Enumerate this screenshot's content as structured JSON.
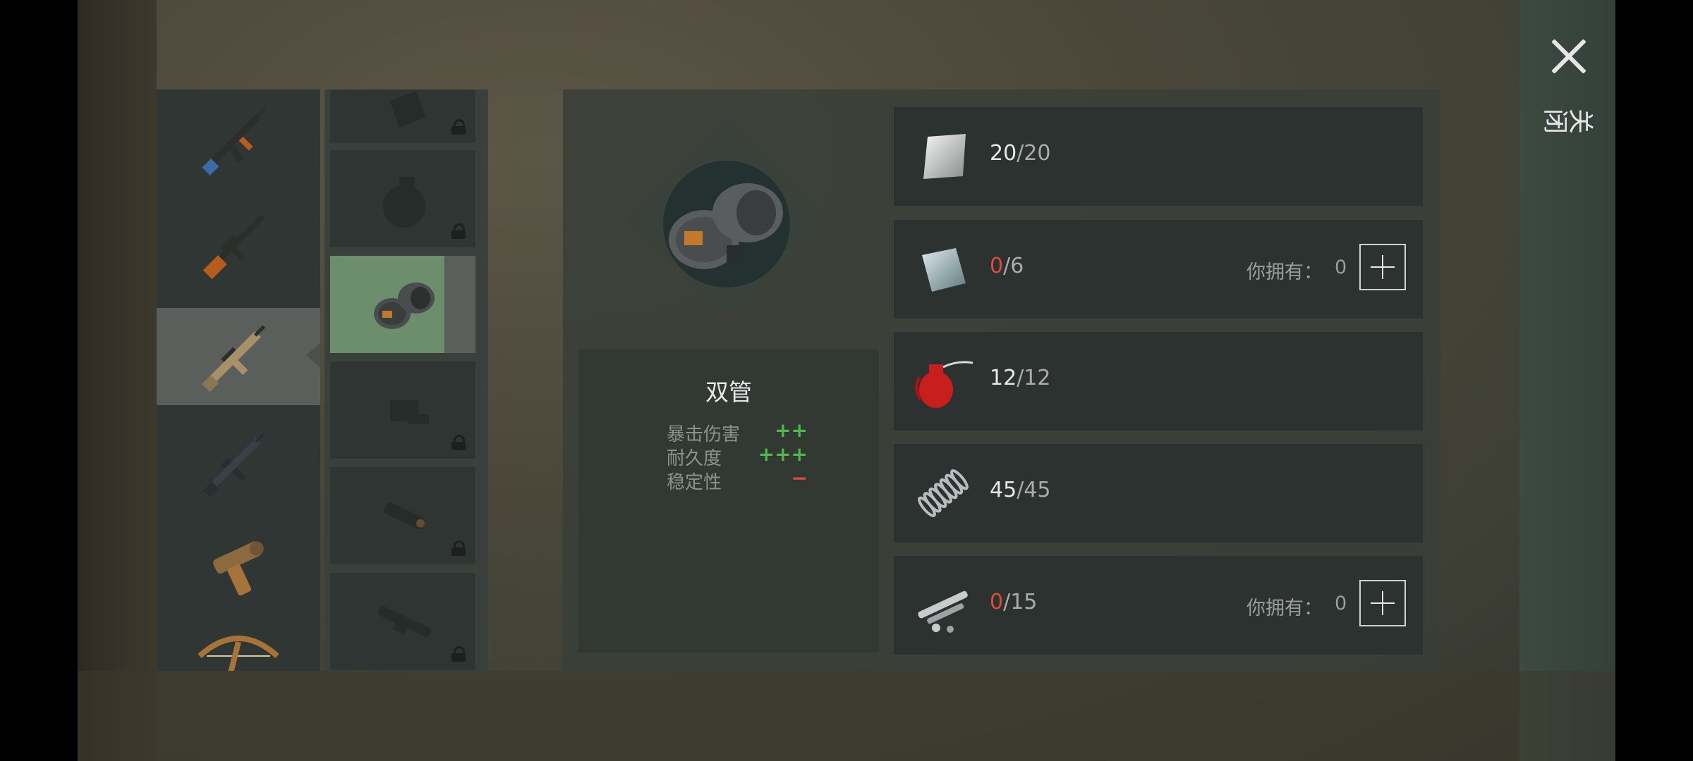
{
  "close": {
    "label": "关闭"
  },
  "weapons": [
    {
      "name": "ak-rifle-icon",
      "stock_color": "#3a6aa8"
    },
    {
      "name": "dragunov-rifle-icon",
      "stock_color": "#b85c1e"
    },
    {
      "name": "scar-rifle-icon",
      "stock_color": "#a8916a",
      "selected": true
    },
    {
      "name": "m4-rifle-icon",
      "stock_color": "#2a2e31"
    },
    {
      "name": "flare-pistol-icon",
      "stock_color": "#a67438"
    },
    {
      "name": "crossbow-icon",
      "stock_color": "#a67438"
    }
  ],
  "attachments": [
    {
      "name": "attachment-locked-top",
      "locked": true
    },
    {
      "name": "drum-magazine-icon",
      "locked": true
    },
    {
      "name": "double-drum-magazine-icon",
      "locked": false,
      "selected": true
    },
    {
      "name": "holographic-sight-icon",
      "locked": true
    },
    {
      "name": "red-dot-sight-icon",
      "locked": true
    },
    {
      "name": "scope-icon",
      "locked": true
    }
  ],
  "item": {
    "title": "双管",
    "stats": [
      {
        "name": "暴击伤害",
        "value": "++",
        "color": "#4fb84a"
      },
      {
        "name": "耐久度",
        "value": "+++",
        "color": "#4fb84a"
      },
      {
        "name": "稳定性",
        "value": "−",
        "color": "#e04a3a"
      }
    ]
  },
  "materials": [
    {
      "icon": "steel-plate-icon",
      "have": "20",
      "need": "20",
      "short": false
    },
    {
      "icon": "blue-metal-plate-icon",
      "have": "0",
      "need": "6",
      "short": true,
      "own_label": "你拥有：",
      "own_value": "0"
    },
    {
      "icon": "oil-can-icon",
      "have": "12",
      "need": "12",
      "short": false
    },
    {
      "icon": "spring-icon",
      "have": "45",
      "need": "45",
      "short": false
    },
    {
      "icon": "weapon-parts-icon",
      "have": "0",
      "need": "15",
      "short": true,
      "own_label": "你拥有：",
      "own_value": "0"
    }
  ]
}
